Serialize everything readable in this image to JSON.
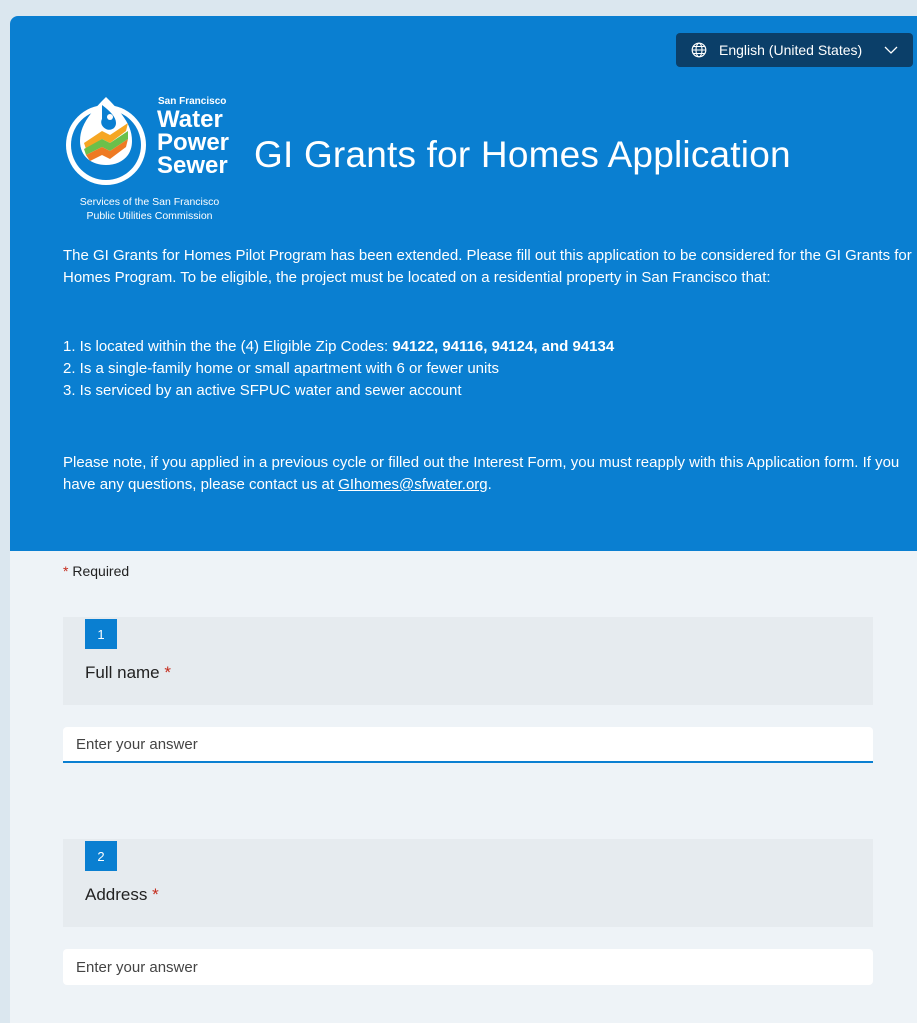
{
  "language": {
    "label": "English (United States)",
    "icon": "globe-icon",
    "chevron": "chevron-down-icon"
  },
  "logo": {
    "top_text": "San Francisco",
    "line1": "Water",
    "line2": "Power",
    "line3": "Sewer",
    "services_line1": "Services of the San Francisco",
    "services_line2": "Public Utilities Commission"
  },
  "header": {
    "title": "GI Grants for Homes Application",
    "intro": "The GI Grants for Homes Pilot Program has been extended. Please fill out this application to be considered for the GI Grants for Homes Program. To be eligible, the project must be located on a residential property in San Francisco that:",
    "list": {
      "item1_prefix": "1. Is located within the the (4) Eligible Zip Codes: ",
      "item1_bold": "94122, 94116, 94124, and 94134",
      "item2": "2. Is a single-family home or small apartment with 6 or fewer units",
      "item3": "3. Is serviced by an active SFPUC water and sewer account"
    },
    "note_prefix": "Please note, if you applied in a previous cycle or filled out the Interest Form, you must reapply with this Application form. If you have any questions, please contact us at ",
    "note_link": "GIhomes@sfwater.org",
    "note_suffix": "."
  },
  "form": {
    "required_star": "*",
    "required_label": "Required",
    "questions": [
      {
        "number": "1",
        "label": "Full name",
        "required_star": "*",
        "placeholder": "Enter your answer"
      },
      {
        "number": "2",
        "label": "Address",
        "required_star": "*",
        "placeholder": "Enter your answer"
      }
    ]
  },
  "colors": {
    "brand_blue": "#0a7fd1",
    "lang_bg": "#0b3f69",
    "required_red": "#c42b1c"
  }
}
